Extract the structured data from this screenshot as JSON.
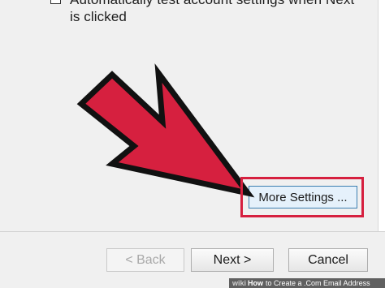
{
  "dialog": {
    "checkbox_label": "Automatically test account settings when Next\nis clicked",
    "more_settings_label": "More Settings ...",
    "back_label": "< Back",
    "next_label": "Next >",
    "cancel_label": "Cancel"
  },
  "overlay": {
    "arrow_color": "#d6203f",
    "highlight_color": "#d6203f"
  },
  "footer": {
    "site": "wiki",
    "how": "How",
    "title": "to Create a .Com Email Address"
  }
}
